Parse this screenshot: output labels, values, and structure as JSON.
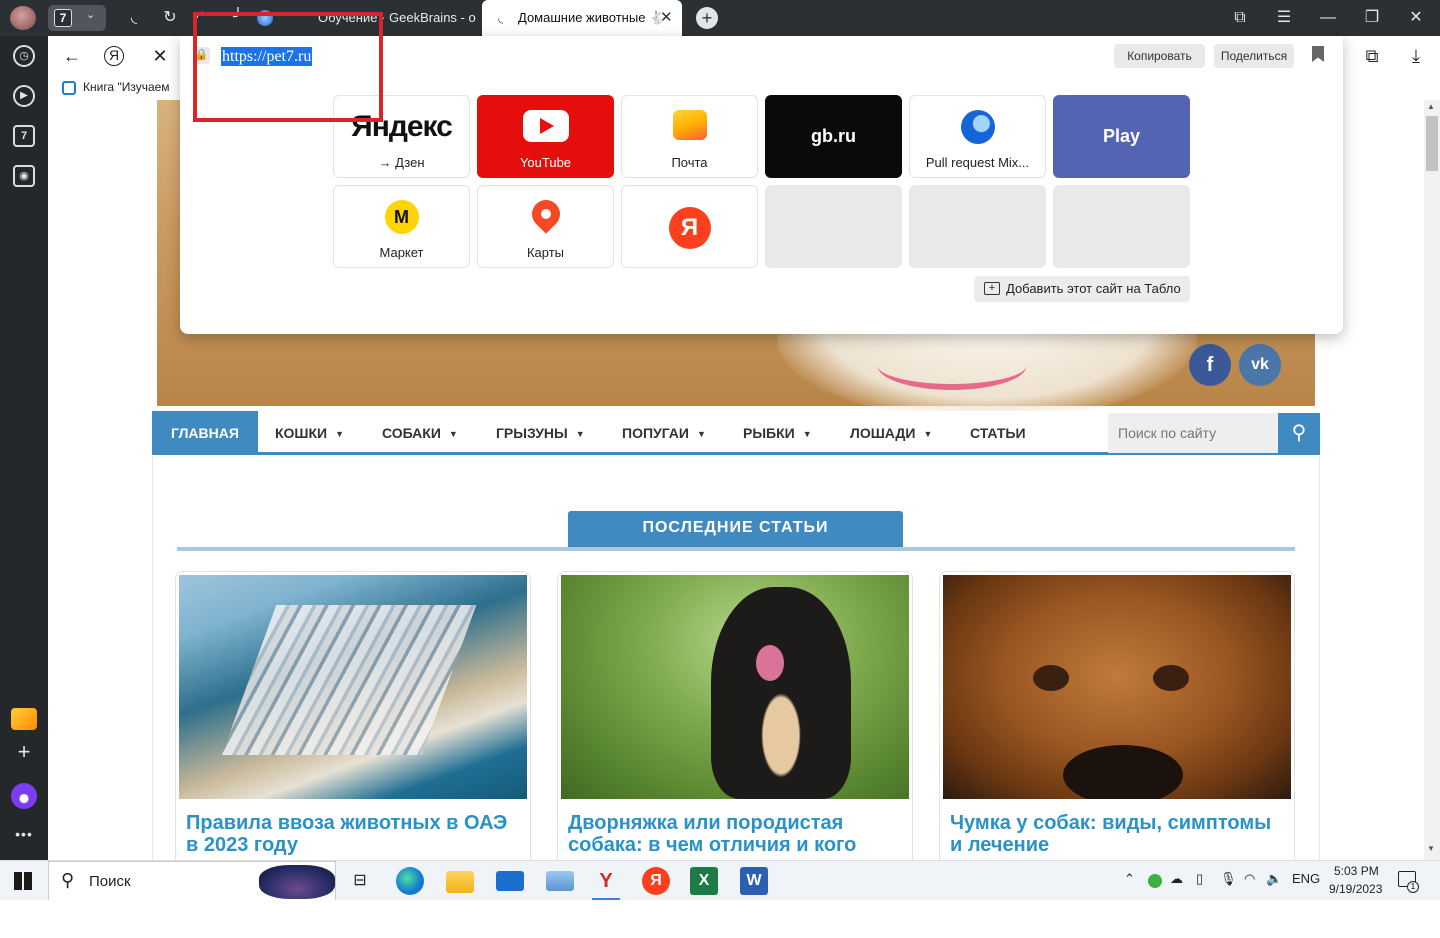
{
  "browser": {
    "tab_counter": "7",
    "tabs": [
      {
        "label": "Обучение · GeekBrains - о"
      },
      {
        "label": "Домашние животные 🐇"
      }
    ],
    "bookmark": "Книга \"Изучаем",
    "address": {
      "url": "https://pet7.ru",
      "copy_label": "Копировать",
      "share_label": "Поделиться"
    }
  },
  "tablo": {
    "tiles": [
      {
        "label": "→ Дзен",
        "logo": "Яндекс",
        "bg": "#ffffff"
      },
      {
        "label": "YouTube",
        "bg": "#e60d0d"
      },
      {
        "label": "Почта",
        "bg": "#ffffff"
      },
      {
        "label": "gb.ru",
        "bg": "#0a0a0a"
      },
      {
        "label": "Pull request Mix...",
        "bg": "#ffffff"
      },
      {
        "label": "Play",
        "bg": "#5563b3"
      },
      {
        "label": "Маркет",
        "bg": "#ffffff"
      },
      {
        "label": "Карты",
        "bg": "#ffffff"
      },
      {
        "label": "",
        "logo": "Я",
        "bg": "#ffffff"
      }
    ],
    "add_label": "Добавить этот сайт на Табло"
  },
  "site": {
    "social": [
      "f",
      "vk"
    ],
    "menu": [
      {
        "label": "ГЛАВНАЯ"
      },
      {
        "label": "КОШКИ"
      },
      {
        "label": "СОБАКИ"
      },
      {
        "label": "ГРЫЗУНЫ"
      },
      {
        "label": "ПОПУГАИ"
      },
      {
        "label": "РЫБКИ"
      },
      {
        "label": "ЛОШАДИ"
      },
      {
        "label": "СТАТЬИ"
      }
    ],
    "search_placeholder": "Поиск по сайту",
    "section_title": "ПОСЛЕДНИЕ СТАТЬИ",
    "articles": [
      {
        "title": "Правила ввоза животных в ОАЭ в 2023 году"
      },
      {
        "title": "Дворняжка или породистая собака: в чем отличия и кого"
      },
      {
        "title": "Чумка у собак: виды, симптомы и лечение"
      }
    ]
  },
  "taskbar": {
    "search_label": "Поиск",
    "lang": "ENG",
    "time": "5:03 PM",
    "date": "9/19/2023",
    "notification_count": "1"
  },
  "colors": {
    "accent": "#3f8ac1",
    "title_link": "#2b92c8",
    "chrome_dark": "#2b3034",
    "highlight_red": "#d6262b"
  }
}
